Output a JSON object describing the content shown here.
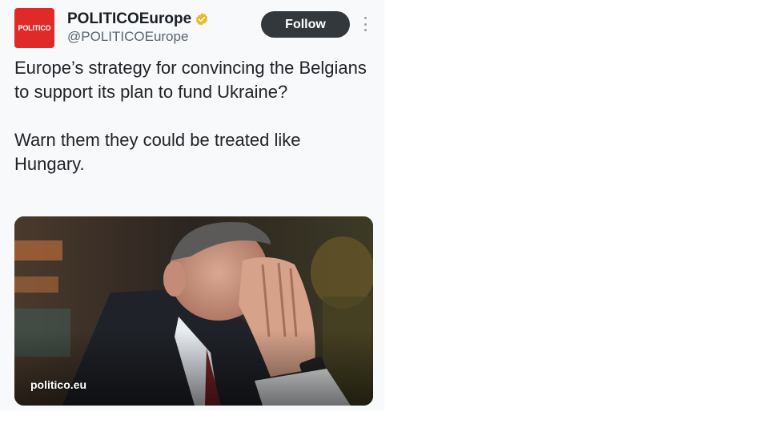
{
  "author": {
    "avatar_text": "POLITICO",
    "display_name": "POLITICOEurope",
    "handle": "@POLITICOEurope",
    "verified_icon": "verified-badge-icon",
    "avatar_color": "#e02a2a",
    "badge_color": "#e8b931"
  },
  "actions": {
    "follow_label": "Follow",
    "more_icon": "more-options-icon"
  },
  "tweet": {
    "paragraph_1": "Europe’s strategy for convincing the Belgians to support its plan to fund Ukraine?",
    "paragraph_2": "Warn them they could be treated like Hungary."
  },
  "media": {
    "link_label": "politico.eu",
    "image_description_icon": "photo-man-covering-face"
  }
}
